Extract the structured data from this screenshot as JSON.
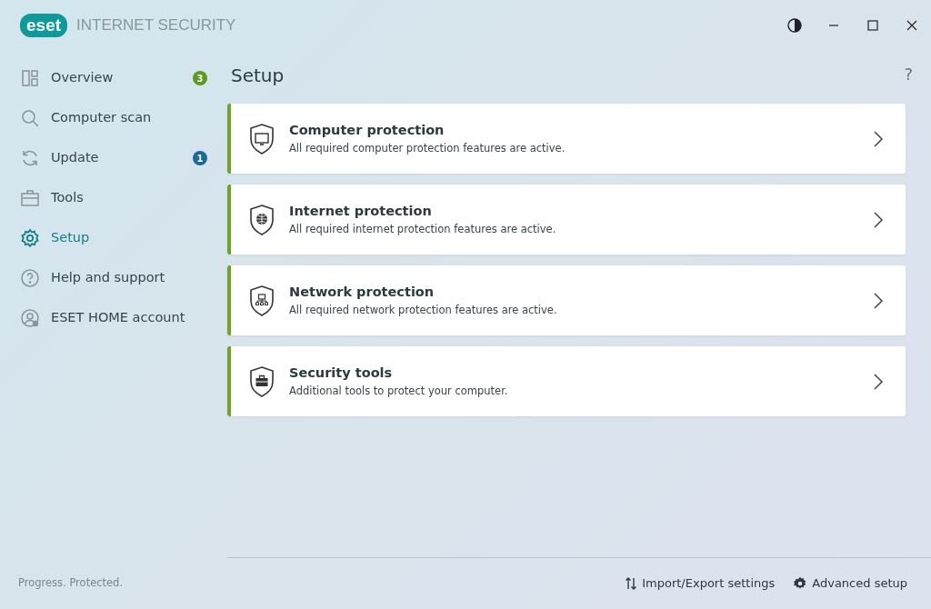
{
  "logo": {
    "mark": "eset",
    "product": "INTERNET SECURITY"
  },
  "window_controls": {
    "help": "?"
  },
  "sidebar": {
    "items": [
      {
        "label": "Overview",
        "kind": "overview",
        "selected": false,
        "badge": {
          "text": "3",
          "color": "#5c9a1c"
        }
      },
      {
        "label": "Computer scan",
        "kind": "scan",
        "selected": false
      },
      {
        "label": "Update",
        "kind": "update",
        "selected": false,
        "badge": {
          "text": "1",
          "color": "#1a6a9a"
        }
      },
      {
        "label": "Tools",
        "kind": "tools",
        "selected": false
      },
      {
        "label": "Setup",
        "kind": "setup",
        "selected": true
      },
      {
        "label": "Help and support",
        "kind": "help",
        "selected": false
      },
      {
        "label": "ESET HOME account",
        "kind": "account",
        "selected": false
      }
    ],
    "tagline": "Progress. Protected."
  },
  "page": {
    "title": "Setup",
    "cards": [
      {
        "title": "Computer protection",
        "description": "All required computer protection features are active.",
        "kind": "computer"
      },
      {
        "title": "Internet protection",
        "description": "All required internet protection features are active.",
        "kind": "internet"
      },
      {
        "title": "Network protection",
        "description": "All required network protection features are active.",
        "kind": "network"
      },
      {
        "title": "Security tools",
        "description": "Additional tools to protect your computer.",
        "kind": "tools"
      }
    ]
  },
  "footer": {
    "links": [
      {
        "label": "Import/Export settings",
        "kind": "import-export"
      },
      {
        "label": "Advanced setup",
        "kind": "advanced"
      }
    ]
  }
}
